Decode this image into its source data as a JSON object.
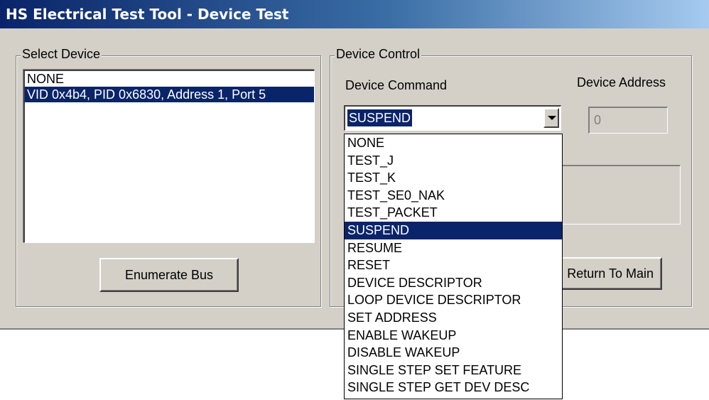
{
  "window": {
    "title": "HS Electrical Test Tool - Device Test"
  },
  "select_device": {
    "legend": "Select Device",
    "items": [
      {
        "label": "NONE",
        "selected": false
      },
      {
        "label": "VID 0x4b4, PID 0x6830, Address 1, Port 5",
        "selected": true
      }
    ],
    "enumerate_button": "Enumerate Bus"
  },
  "device_control": {
    "legend": "Device Control",
    "command_label": "Device Command",
    "address_label": "Device Address",
    "command_value": "SUSPEND",
    "address_value": "0",
    "return_button": "Return To Main",
    "command_options": [
      "NONE",
      "TEST_J",
      "TEST_K",
      "TEST_SE0_NAK",
      "TEST_PACKET",
      "SUSPEND",
      "RESUME",
      "RESET",
      "DEVICE DESCRIPTOR",
      "LOOP DEVICE DESCRIPTOR",
      "SET ADDRESS",
      "ENABLE WAKEUP",
      "DISABLE WAKEUP",
      "SINGLE STEP SET FEATURE",
      "SINGLE STEP GET DEV DESC"
    ],
    "highlighted_option": "SUSPEND"
  },
  "colors": {
    "selection": "#0a246a",
    "face": "#d4d0c8"
  }
}
